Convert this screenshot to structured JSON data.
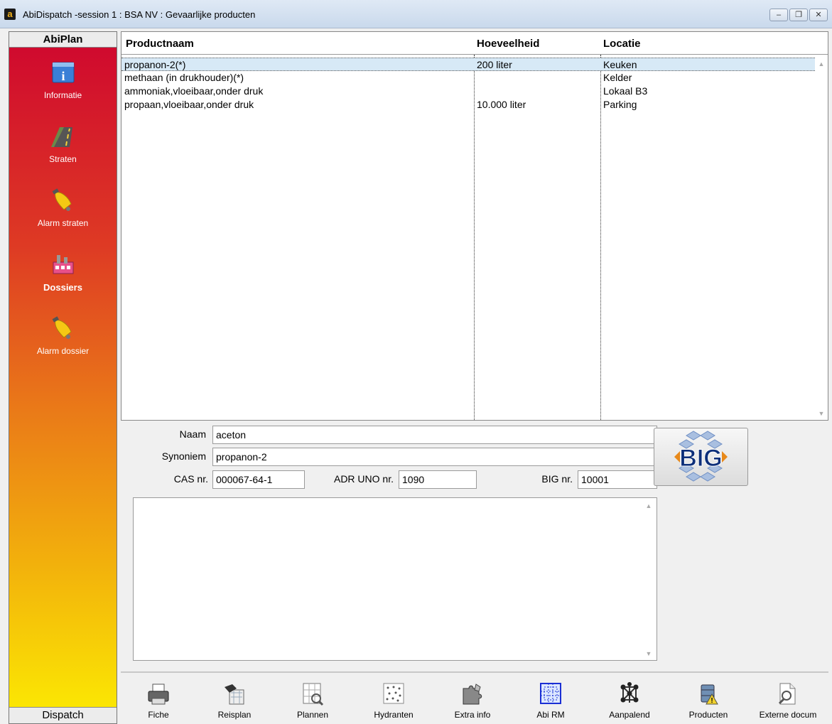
{
  "window": {
    "title": "AbiDispatch  -session 1 : BSA NV : Gevaarlijke producten",
    "app_icon_letter": "a",
    "buttons": {
      "minimize": "–",
      "restore": "❐",
      "close": "✕"
    }
  },
  "sidebar": {
    "header": "AbiPlan",
    "footer": "Dispatch",
    "items": [
      {
        "label": "Informatie",
        "icon": "info-icon"
      },
      {
        "label": "Straten",
        "icon": "road-icon"
      },
      {
        "label": "Alarm straten",
        "icon": "bell-icon"
      },
      {
        "label": "Dossiers",
        "icon": "factory-icon",
        "active": true
      },
      {
        "label": "Alarm dossier",
        "icon": "bell-icon"
      }
    ]
  },
  "table": {
    "columns": [
      "Productnaam",
      "Hoeveelheid",
      "Locatie"
    ],
    "rows": [
      {
        "name": "propanon-2(*)",
        "amount": "200 liter",
        "location": "Keuken",
        "selected": true
      },
      {
        "name": "methaan (in drukhouder)(*)",
        "amount": "",
        "location": "Kelder"
      },
      {
        "name": "ammoniak,vloeibaar,onder druk",
        "amount": "",
        "location": "Lokaal B3"
      },
      {
        "name": "propaan,vloeibaar,onder druk",
        "amount": "10.000 liter",
        "location": "Parking"
      }
    ]
  },
  "detail": {
    "naam_label": "Naam",
    "naam_value": "aceton",
    "synoniem_label": "Synoniem",
    "synoniem_value": "propanon-2",
    "cas_label": "CAS nr.",
    "cas_value": "000067-64-1",
    "adr_label": "ADR UNO nr.",
    "adr_value": "1090",
    "big_label": "BIG nr.",
    "big_value": "10001",
    "big_button_text": "BIG",
    "notes_value": ""
  },
  "toolbar": {
    "items": [
      {
        "label": "Fiche",
        "icon": "printer-icon"
      },
      {
        "label": "Reisplan",
        "icon": "route-map-icon"
      },
      {
        "label": "Plannen",
        "icon": "plan-zoom-icon"
      },
      {
        "label": "Hydranten",
        "icon": "hydrant-map-icon"
      },
      {
        "label": "Extra info",
        "icon": "puzzle-icon"
      },
      {
        "label": "Abi RM",
        "icon": "grid-icon"
      },
      {
        "label": "Aanpalend",
        "icon": "network-icon"
      },
      {
        "label": "Producten",
        "icon": "hazard-barrel-icon"
      },
      {
        "label": "Externe docum",
        "icon": "document-search-icon"
      }
    ]
  },
  "colors": {
    "sidebar_top": "#d00a2e",
    "sidebar_bottom": "#fbe603",
    "selected_row": "#d7e9f6"
  }
}
